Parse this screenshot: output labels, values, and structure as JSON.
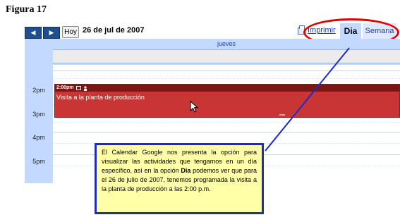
{
  "figure_title": "Figura 17",
  "toolbar": {
    "prev_label": "◀",
    "next_label": "▶",
    "today_label": "Hoy",
    "date_label": "26 de jul de 2007",
    "print_label": "Imprimir",
    "tabs": [
      {
        "label": "Dia",
        "selected": true
      },
      {
        "label": "Semana",
        "selected": false
      }
    ]
  },
  "calendar": {
    "day_header": "jueves",
    "hours": [
      "2pm",
      "3pm",
      "4pm",
      "5pm"
    ],
    "event": {
      "time": "2:00pm",
      "title": "Visita a la planta de producción",
      "color": "#c93434"
    }
  },
  "callout": {
    "text_before": "El Calendar Google nos presenta la opción para visualizar las actividades que tengamos en un día específico, así en la opción ",
    "bold_word": "Dia",
    "text_after": " podemos ver que para el 26 de julio de 2007, tenemos programada la visita a la planta de producción a las 2:00 p.m."
  },
  "colors": {
    "highlight_ellipse": "#e00000",
    "callout_border": "#1b2cc8",
    "callout_background": "#ffffa8"
  }
}
